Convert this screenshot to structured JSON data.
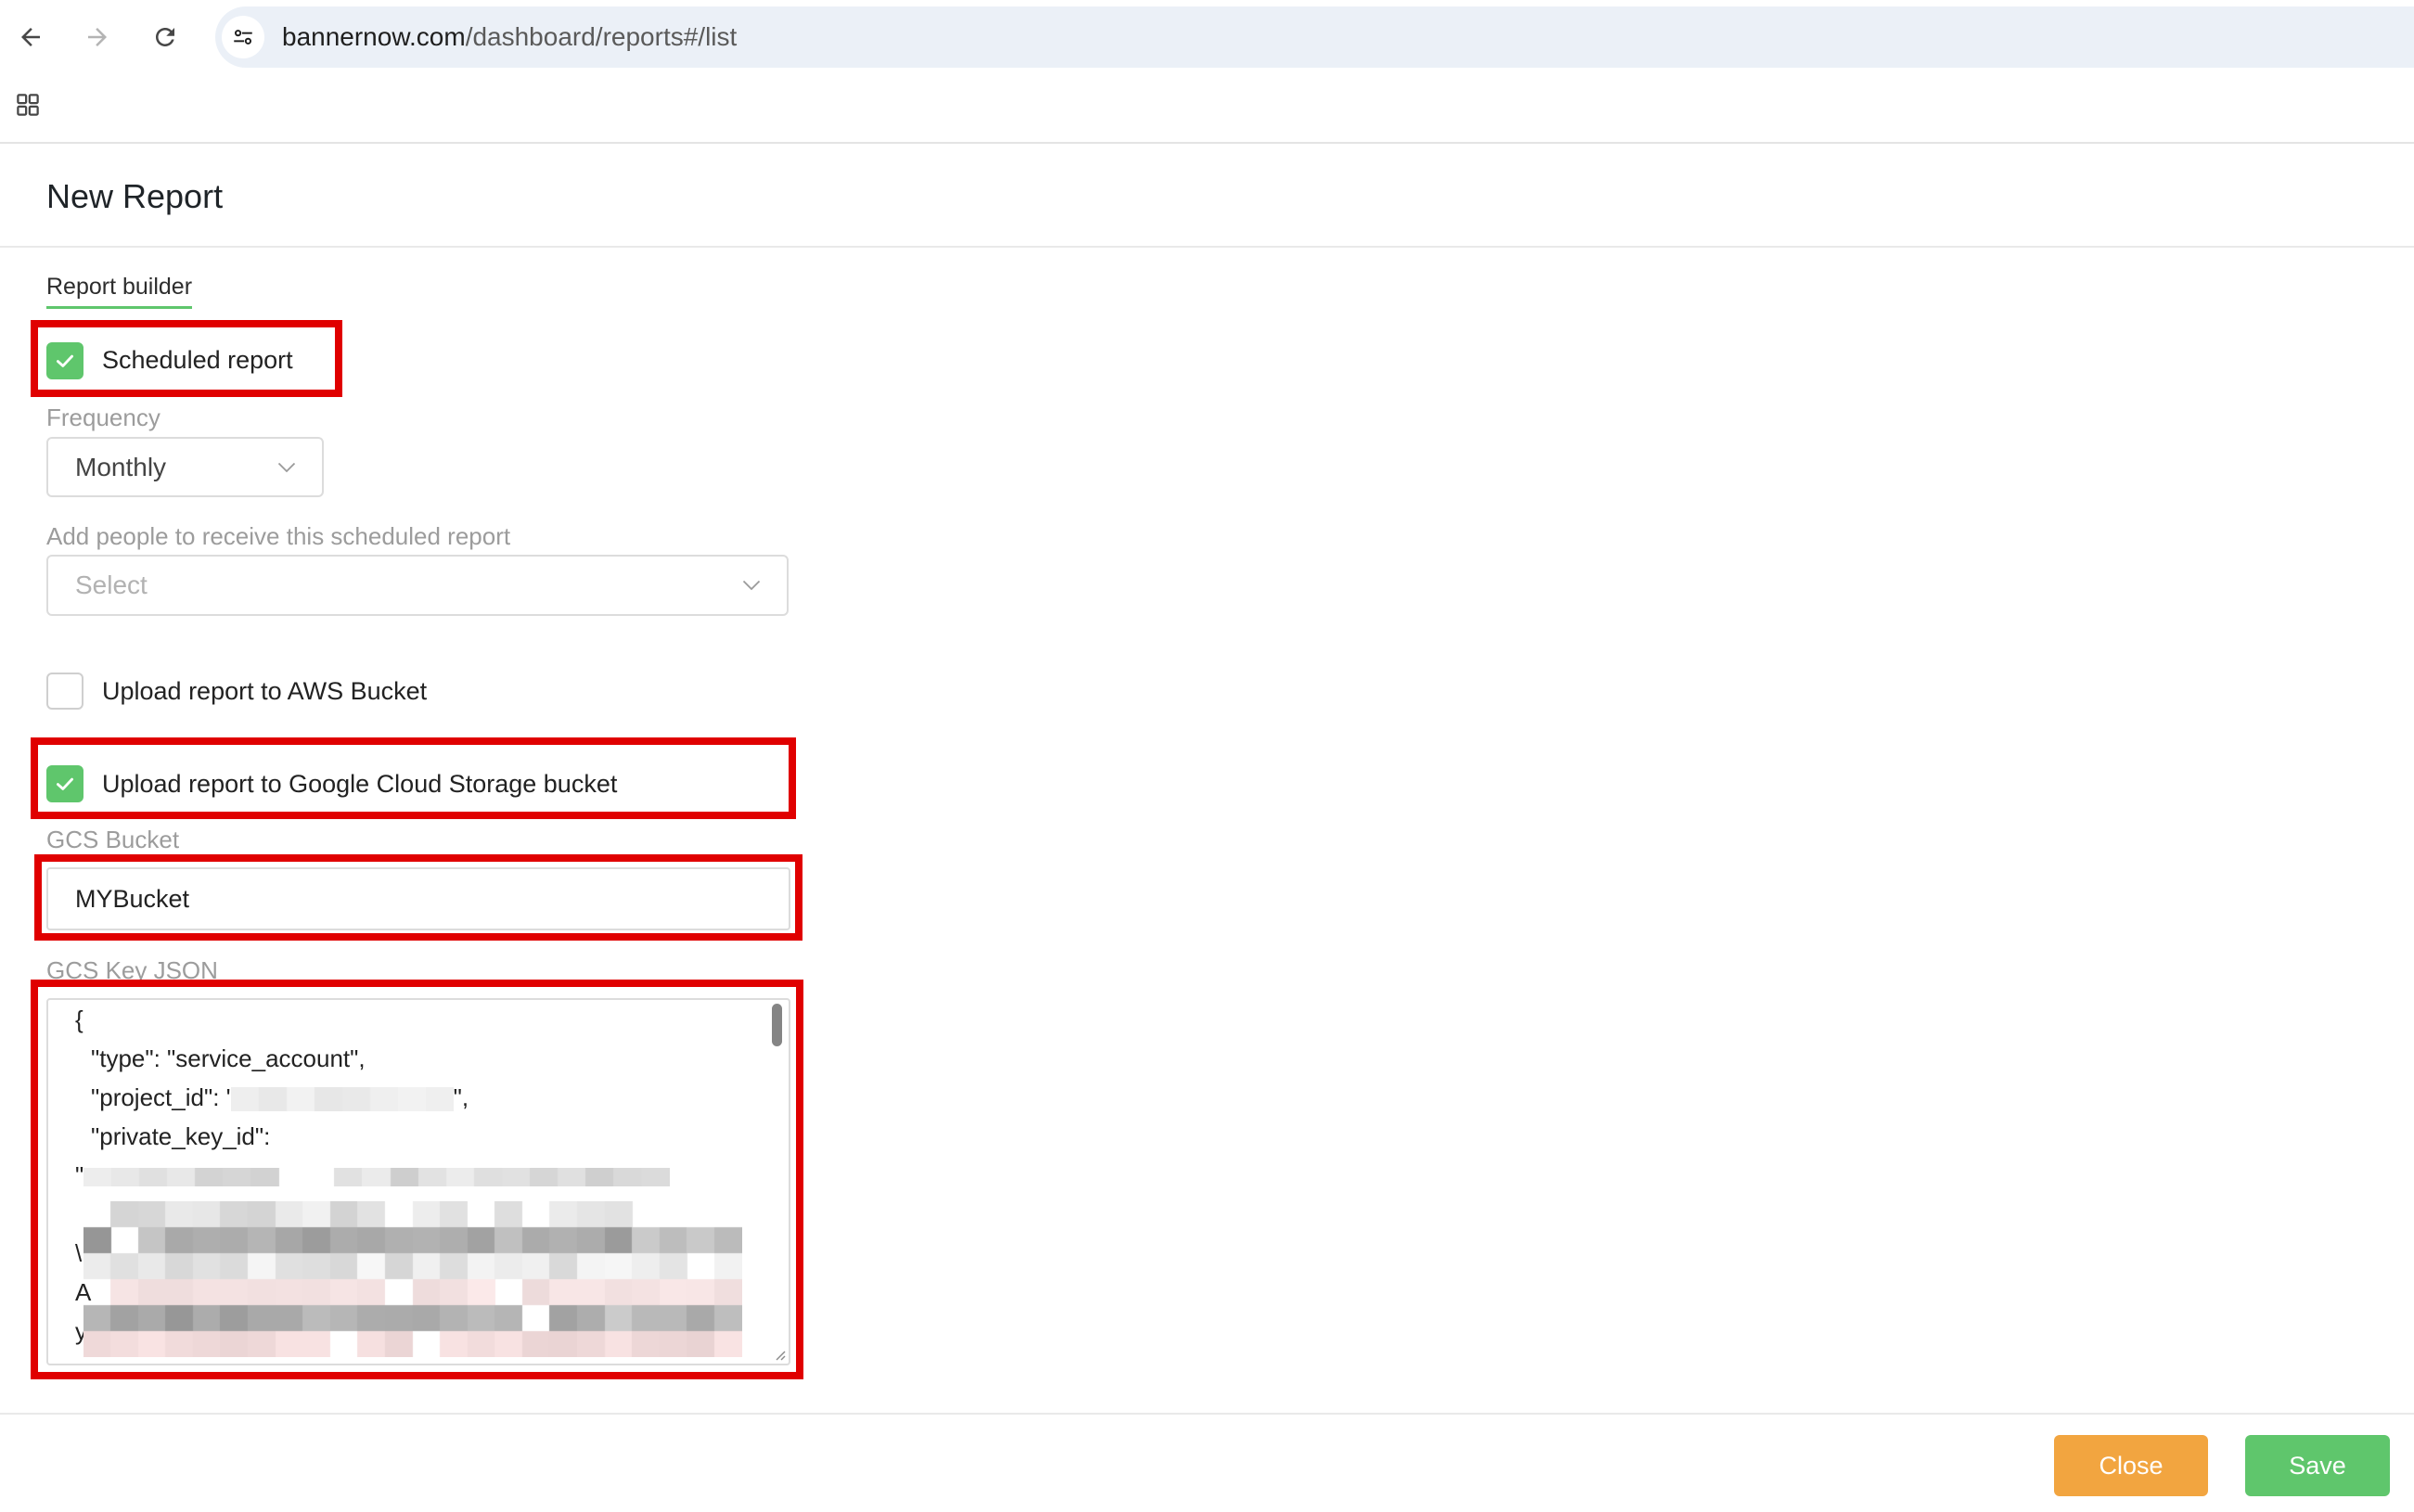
{
  "browser": {
    "url_domain": "bannernow.com",
    "url_path": "/dashboard/reports#/list",
    "icons": {
      "back": "arrow-left-icon",
      "forward": "arrow-right-icon",
      "reload": "reload-icon",
      "site_info": "tune-icon",
      "apps": "apps-grid-icon"
    }
  },
  "dialog": {
    "title": "New Report",
    "tabs": [
      {
        "label": "Report builder",
        "active": true
      }
    ]
  },
  "form": {
    "scheduled_report": {
      "label": "Scheduled report",
      "checked": true
    },
    "frequency": {
      "label": "Frequency",
      "value": "Monthly"
    },
    "recipients": {
      "label": "Add people to receive this scheduled report",
      "placeholder": "Select"
    },
    "aws_upload": {
      "label": "Upload report to AWS Bucket",
      "checked": false
    },
    "gcs_upload": {
      "label": "Upload report to Google Cloud Storage bucket",
      "checked": true
    },
    "gcs_bucket": {
      "label": "GCS Bucket",
      "value": "MYBucket"
    },
    "gcs_key_json": {
      "label": "GCS Key JSON",
      "lines": {
        "open_brace": "{",
        "type": "\"type\": \"service_account\",",
        "project_id_prefix": "\"project_id\": '",
        "project_id_suffix": "\",",
        "private_key_id": "\"private_key_id\":",
        "private_key_id_value_start": "\"",
        "key_line_a": "\\",
        "key_line_b": "A",
        "key_line_c": "y"
      }
    }
  },
  "footer": {
    "close_label": "Close",
    "save_label": "Save"
  },
  "colors": {
    "accent_green": "#5fc66c",
    "close_orange": "#f2a540",
    "highlight_red": "#e00000",
    "url_bar": "#ebf0f7"
  }
}
